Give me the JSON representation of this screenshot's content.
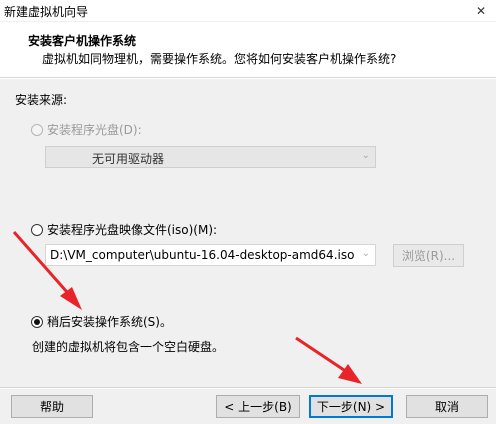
{
  "window": {
    "title": "新建虚拟机向导"
  },
  "header": {
    "title": "安装客户机操作系统",
    "subtitle": "虚拟机如同物理机，需要操作系统。您将如何安装客户机操作系统?"
  },
  "source": {
    "label": "安装来源:",
    "options": [
      {
        "label": "安装程序光盘(D):",
        "selected": false,
        "enabled": false
      },
      {
        "label": "安装程序光盘映像文件(iso)(M):",
        "selected": false,
        "enabled": true
      },
      {
        "label": "稍后安装操作系统(S)。",
        "selected": true,
        "enabled": true
      }
    ],
    "drive_select": {
      "value": "无可用驱动器"
    },
    "iso_path": {
      "value": "D:\\VM_computer\\ubuntu-16.04-desktop-amd64.iso"
    },
    "browse_label": "浏览(R)...",
    "later_description": "创建的虚拟机将包含一个空白硬盘。"
  },
  "footer": {
    "help_label": "帮助",
    "back_label": "< 上一步(B)",
    "next_label": "下一步(N) >",
    "cancel_label": "取消"
  },
  "annotation_color": "#e8232a"
}
